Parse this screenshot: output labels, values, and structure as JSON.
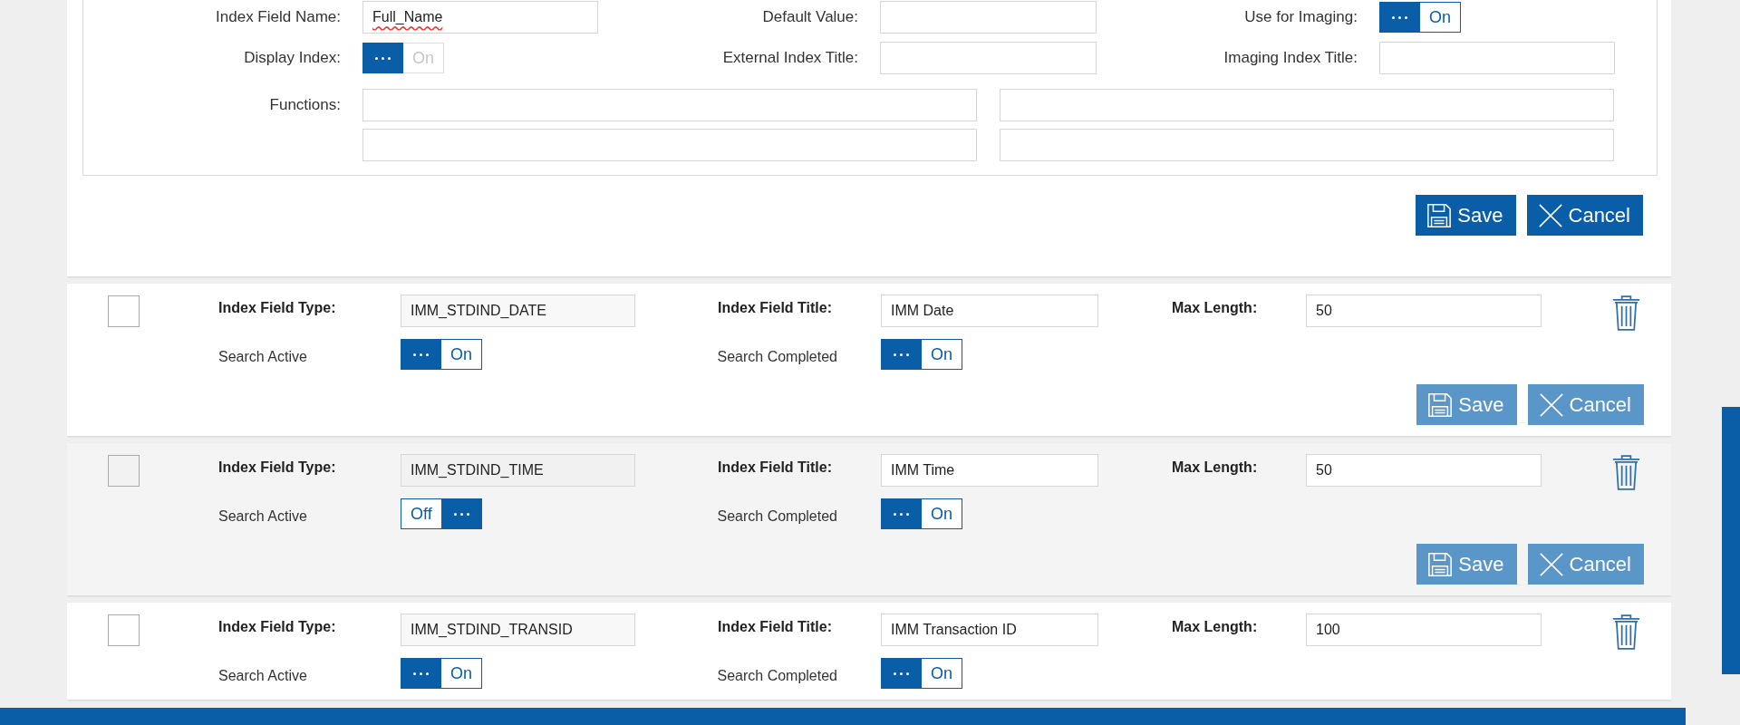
{
  "form": {
    "fields": [
      {
        "label": "Index Field Name:",
        "kind": "text",
        "value": "Full_Name",
        "spelling_error": true
      },
      {
        "label": "Default Value:",
        "kind": "text"
      },
      {
        "label": "Use for Imaging:",
        "kind": "toggle",
        "on": true,
        "disabled": false,
        "text": "On"
      },
      {
        "label": "Display Index:",
        "kind": "toggle",
        "on": true,
        "disabled": true,
        "text": "On"
      },
      {
        "label": "External Index Title:",
        "kind": "text"
      },
      {
        "label": "Imaging Index Title:",
        "kind": "text"
      }
    ],
    "functions_label": "Functions:",
    "buttons": [
      {
        "kind": "save",
        "label": "Save",
        "disabled": false
      },
      {
        "kind": "cancel",
        "label": "Cancel",
        "disabled": false
      }
    ]
  },
  "index_fields": [
    {
      "checked": false,
      "highlighted": false,
      "type_label": "Index Field Type:",
      "type": "IMM_STDIND_DATE",
      "title_label": "Index Field Title:",
      "title": "IMM Date",
      "max_label": "Max Length:",
      "max_length": "50",
      "search_active": {
        "label": "Search Active",
        "on": true,
        "text": "On"
      },
      "search_completed": {
        "label": "Search Completed",
        "on": true,
        "text": "On"
      },
      "buttons": [
        {
          "kind": "save",
          "label": "Save",
          "disabled": true
        },
        {
          "kind": "cancel",
          "label": "Cancel",
          "disabled": true
        }
      ]
    },
    {
      "checked": false,
      "highlighted": true,
      "type_label": "Index Field Type:",
      "type": "IMM_STDIND_TIME",
      "title_label": "Index Field Title:",
      "title": "IMM Time",
      "max_label": "Max Length:",
      "max_length": "50",
      "search_active": {
        "label": "Search Active",
        "on": false,
        "text": "Off"
      },
      "search_completed": {
        "label": "Search Completed",
        "on": true,
        "text": "On"
      },
      "buttons": [
        {
          "kind": "save",
          "label": "Save",
          "disabled": true
        },
        {
          "kind": "cancel",
          "label": "Cancel",
          "disabled": true
        }
      ]
    },
    {
      "checked": false,
      "highlighted": false,
      "type_label": "Index Field Type:",
      "type": "IMM_STDIND_TRANSID",
      "title_label": "Index Field Title:",
      "title": "IMM Transaction ID",
      "max_label": "Max Length:",
      "max_length": "100",
      "search_active": {
        "label": "Search Active",
        "on": true,
        "text": "On"
      },
      "search_completed": {
        "label": "Search Completed",
        "on": true,
        "text": "On"
      }
    }
  ]
}
